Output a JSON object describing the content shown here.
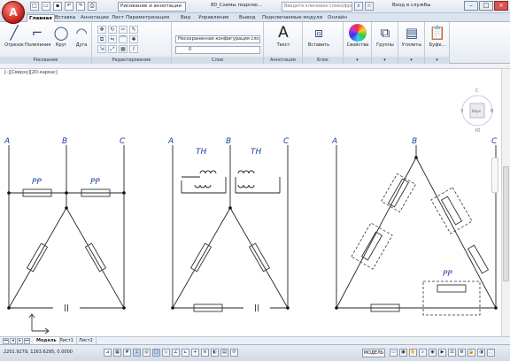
{
  "app": {
    "logo_letter": "A",
    "workspace": "Рисование и аннотации",
    "title": "80_Схемы подклю...",
    "search_placeholder": "Введите ключевое слово/фразу",
    "login": "Вход в службы",
    "quick_access_icons": [
      "new-icon",
      "open-icon",
      "save-icon",
      "undo-icon",
      "redo-icon",
      "print-icon"
    ]
  },
  "ribbon_tabs": [
    {
      "label": "Главная",
      "active": true
    },
    {
      "label": "Вставка"
    },
    {
      "label": "Аннотации"
    },
    {
      "label": "Лист"
    },
    {
      "label": "Параметризация"
    },
    {
      "label": "Вид"
    },
    {
      "label": "Управление"
    },
    {
      "label": "Вывод"
    },
    {
      "label": "Подключаемые модули"
    },
    {
      "label": "Онлайн"
    }
  ],
  "ribbon": {
    "draw": {
      "tools": [
        {
          "label": "Отрезок",
          "icon": "line-icon"
        },
        {
          "label": "Полилиния",
          "icon": "polyline-icon"
        },
        {
          "label": "Круг",
          "icon": "circle-icon"
        },
        {
          "label": "Дуга",
          "icon": "arc-icon"
        }
      ],
      "panel_label": "Рисование"
    },
    "modify": {
      "panel_label": "Редактирование"
    },
    "layers": {
      "current_layer": "Несохраненная конфигурация сло",
      "layer_value": "0",
      "panel_label": "Слои"
    },
    "annotation": {
      "text_label": "Текст",
      "panel_label": "Аннотации"
    },
    "block": {
      "insert_label": "Вставить",
      "panel_label": "Блок"
    },
    "properties": {
      "label": "Свойства"
    },
    "groups": {
      "label": "Группы"
    },
    "utilities": {
      "label": "Утилиты"
    },
    "clipboard": {
      "label": "Буфе..."
    }
  },
  "viewport": {
    "label": "[–][Сверху][2D-каркас]",
    "viewcube": {
      "top": "С",
      "bottom": "Ю",
      "left": "З",
      "right": "В",
      "face": "Верх",
      "wcs": "МСК"
    }
  },
  "drawing": {
    "phase_labels": [
      "A",
      "B",
      "C"
    ],
    "resistor_label": "РР",
    "transformer_label": "ТН"
  },
  "layout_tabs": [
    {
      "label": "Модель",
      "active": true
    },
    {
      "label": "Лист1"
    },
    {
      "label": "Лист2"
    }
  ],
  "status": {
    "coordinates": "2201.9279, 1263.6295, 0.0000",
    "model_label": "МОДЕЛЬ"
  }
}
